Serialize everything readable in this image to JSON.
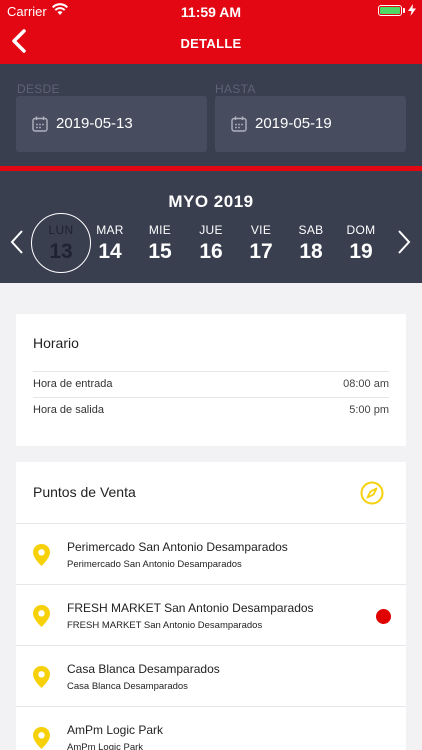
{
  "status_bar": {
    "carrier": "Carrier",
    "time": "11:59 AM"
  },
  "nav": {
    "title": "DETALLE",
    "back_icon": "chevron-left-icon"
  },
  "range": {
    "from_label": "DESDE",
    "from_value": "2019-05-13",
    "to_label": "HASTA",
    "to_value": "2019-05-19"
  },
  "week": {
    "month": "MYO 2019",
    "days": [
      {
        "name": "LUN",
        "num": "13",
        "selected": true
      },
      {
        "name": "MAR",
        "num": "14"
      },
      {
        "name": "MIE",
        "num": "15"
      },
      {
        "name": "JUE",
        "num": "16"
      },
      {
        "name": "VIE",
        "num": "17"
      },
      {
        "name": "SAB",
        "num": "18"
      },
      {
        "name": "DOM",
        "num": "19"
      }
    ]
  },
  "horario": {
    "title": "Horario",
    "rows": [
      {
        "label": "Hora de entrada",
        "value": "08:00 am"
      },
      {
        "label": "Hora de salida",
        "value": "5:00 pm"
      }
    ]
  },
  "puntos": {
    "title": "Puntos de Venta",
    "items": [
      {
        "name": "Perimercado San Antonio Desamparados",
        "sub": "Perimercado San Antonio Desamparados",
        "alert": false
      },
      {
        "name": "FRESH MARKET San Antonio Desamparados",
        "sub": "FRESH MARKET San Antonio Desamparados",
        "alert": true
      },
      {
        "name": "Casa Blanca Desamparados",
        "sub": "Casa Blanca Desamparados",
        "alert": false
      },
      {
        "name": "AmPm Logic Park",
        "sub": "AmPm Logic Park",
        "alert": false
      }
    ]
  },
  "colors": {
    "brand_red": "#e30613",
    "dark_panel": "#3a3f50",
    "pin_yellow": "#f6d10a",
    "alert_red": "#e00000"
  }
}
